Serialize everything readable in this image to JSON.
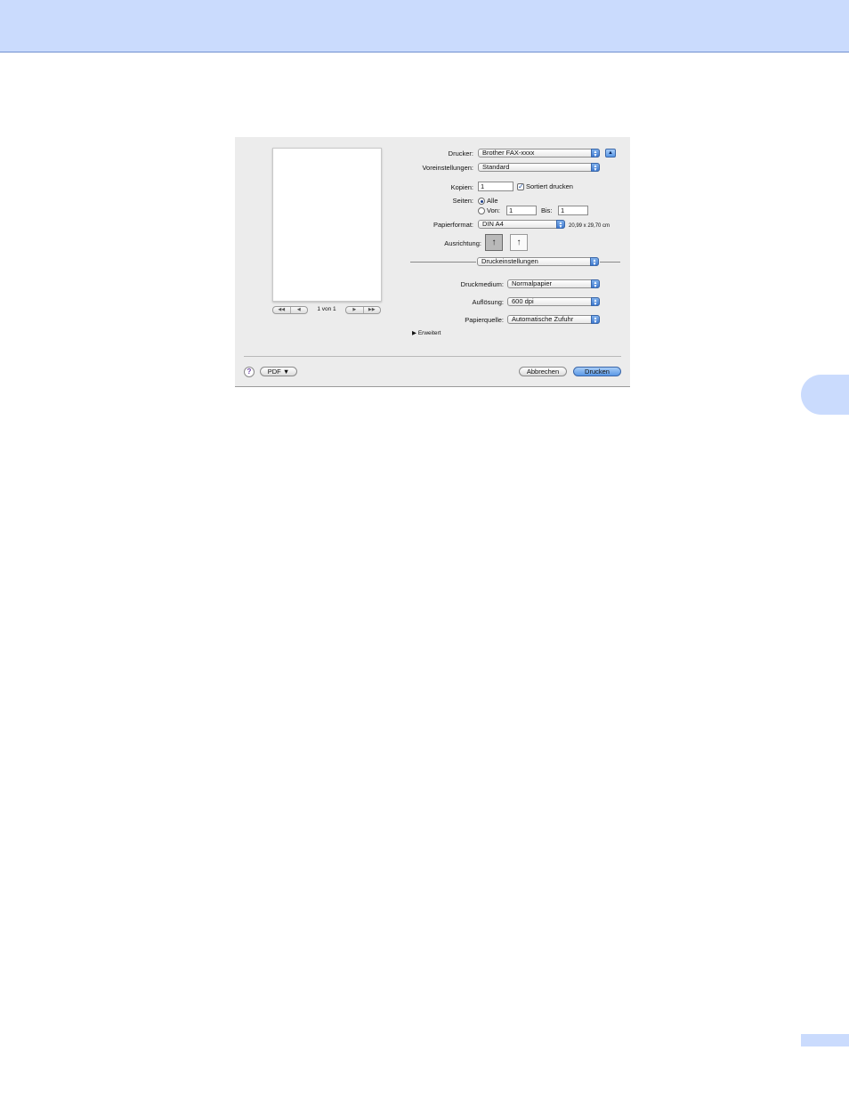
{
  "dialog": {
    "preview": {
      "page_indicator": "1 von 1",
      "nav_first": "◀◀",
      "nav_prev": "◀",
      "nav_next": "▶",
      "nav_last": "▶▶"
    },
    "printer": {
      "label": "Drucker:",
      "value": "Brother FAX-xxxx"
    },
    "presets": {
      "label": "Voreinstellungen:",
      "value": "Standard"
    },
    "copies": {
      "label": "Kopien:",
      "value": "1",
      "collate_label": "Sortiert drucken",
      "collate_checked": true
    },
    "pages": {
      "label": "Seiten:",
      "all_label": "Alle",
      "from_label": "Von:",
      "from_value": "1",
      "to_label": "Bis:",
      "to_value": "1",
      "selected": "all"
    },
    "paper_size": {
      "label": "Papierformat:",
      "value": "DIN A4",
      "dimensions": "20,99 x 29,70 cm"
    },
    "orientation": {
      "label": "Ausrichtung:",
      "selected": "portrait"
    },
    "panel": {
      "value": "Druckeinstellungen"
    },
    "media": {
      "label": "Druckmedium:",
      "value": "Normalpapier"
    },
    "resolution": {
      "label": "Auflösung:",
      "value": "600 dpi"
    },
    "paper_source": {
      "label": "Papierquelle:",
      "value": "Automatische Zufuhr"
    },
    "advanced": {
      "label": "Erweitert"
    },
    "pdf_button": "PDF ▼",
    "help_symbol": "?",
    "cancel_button": "Abbrechen",
    "print_button": "Drucken"
  },
  "colors": {
    "header": "#cadbfd",
    "accent": "#5a98e6"
  }
}
